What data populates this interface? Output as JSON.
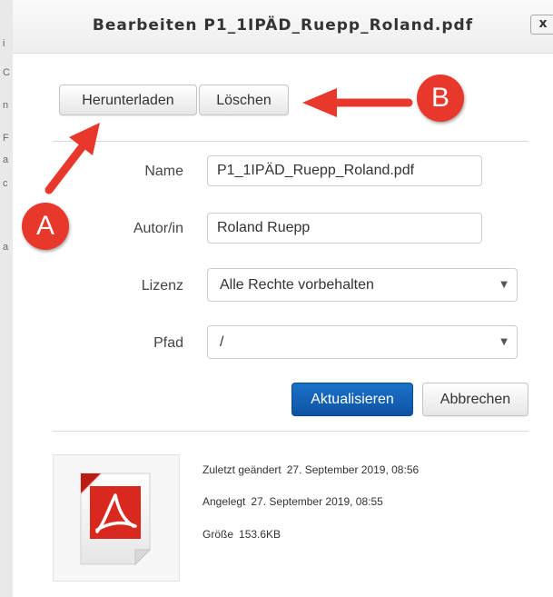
{
  "dialog": {
    "title": "Bearbeiten P1_1IPÄD_Ruepp_Roland.pdf",
    "close_label": "x"
  },
  "left_strip_glyphs": [
    "i",
    "C",
    "n",
    "F",
    "a",
    "c",
    "a"
  ],
  "toolbar": {
    "download_label": "Herunterladen",
    "delete_label": "Löschen"
  },
  "form": {
    "name_label": "Name",
    "name_value": "P1_1IPÄD_Ruepp_Roland.pdf",
    "author_label": "Autor/in",
    "author_value": "Roland Ruepp",
    "license_label": "Lizenz",
    "license_value": "Alle Rechte vorbehalten",
    "path_label": "Pfad",
    "path_value": "/",
    "update_label": "Aktualisieren",
    "cancel_label": "Abbrechen"
  },
  "file_info": {
    "modified_label": "Zuletzt geändert",
    "modified_value": "27. September 2019, 08:56",
    "created_label": "Angelegt",
    "created_value": "27. September 2019, 08:55",
    "size_label": "Größe",
    "size_value": "153.6KB",
    "thumbnail_icon": "pdf-file-icon"
  },
  "annotations": {
    "callout_a": "A",
    "callout_b": "B",
    "color": "#e8382c"
  },
  "colors": {
    "primary_button": "#0e52a3",
    "annotation_red": "#e8382c"
  }
}
